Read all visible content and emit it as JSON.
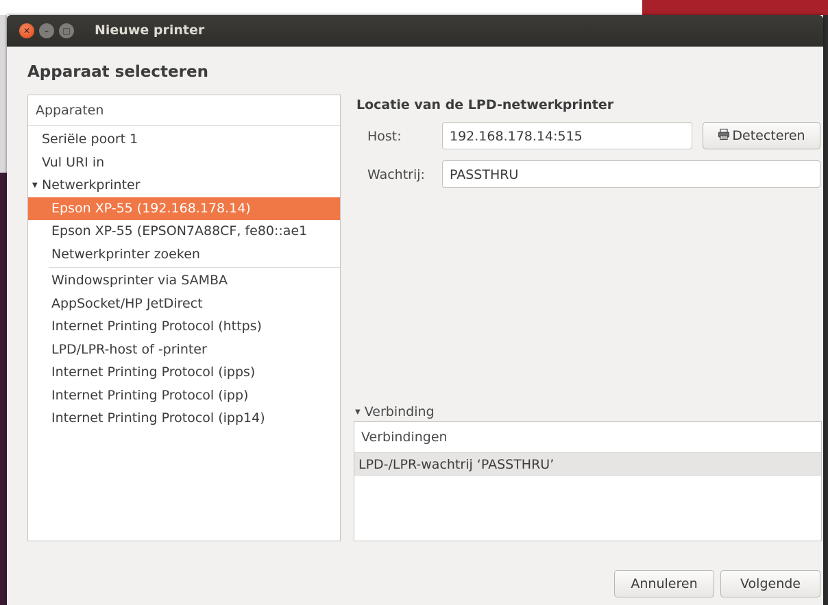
{
  "window": {
    "title": "Nieuwe printer"
  },
  "page": {
    "heading": "Apparaat selecteren"
  },
  "devices": {
    "header": "Apparaten",
    "items": [
      {
        "label": "Seriële poort 1"
      },
      {
        "label": "Vul URI in"
      },
      {
        "label": "Netwerkprinter",
        "expanded": true
      },
      {
        "label": "Epson XP-55 (192.168.178.14)",
        "selected": true
      },
      {
        "label": "Epson XP-55 (EPSON7A88CF, fe80::ae1"
      },
      {
        "label": "Netwerkprinter zoeken"
      },
      {
        "label": "Windowsprinter via SAMBA"
      },
      {
        "label": "AppSocket/HP JetDirect"
      },
      {
        "label": "Internet Printing Protocol (https)"
      },
      {
        "label": "LPD/LPR-host of -printer"
      },
      {
        "label": "Internet Printing Protocol (ipps)"
      },
      {
        "label": "Internet Printing Protocol (ipp)"
      },
      {
        "label": "Internet Printing Protocol (ipp14)"
      }
    ]
  },
  "location": {
    "title": "Locatie van de LPD-netwerkprinter",
    "host_label": "Host:",
    "host_value": "192.168.178.14:515",
    "detect_label": "Detecteren",
    "detect_icon": "printer-icon",
    "queue_label": "Wachtrij:",
    "queue_value": "PASSTHRU"
  },
  "connection": {
    "expander_label": "Verbinding",
    "header": "Verbindingen",
    "rows": [
      "LPD-/LPR-wachtrij ‘PASSTHRU’"
    ]
  },
  "buttons": {
    "cancel": "Annuleren",
    "next": "Volgende"
  },
  "colors": {
    "selection": "#f07746",
    "titlebar": "#3c3b37",
    "close": "#df4a16"
  }
}
